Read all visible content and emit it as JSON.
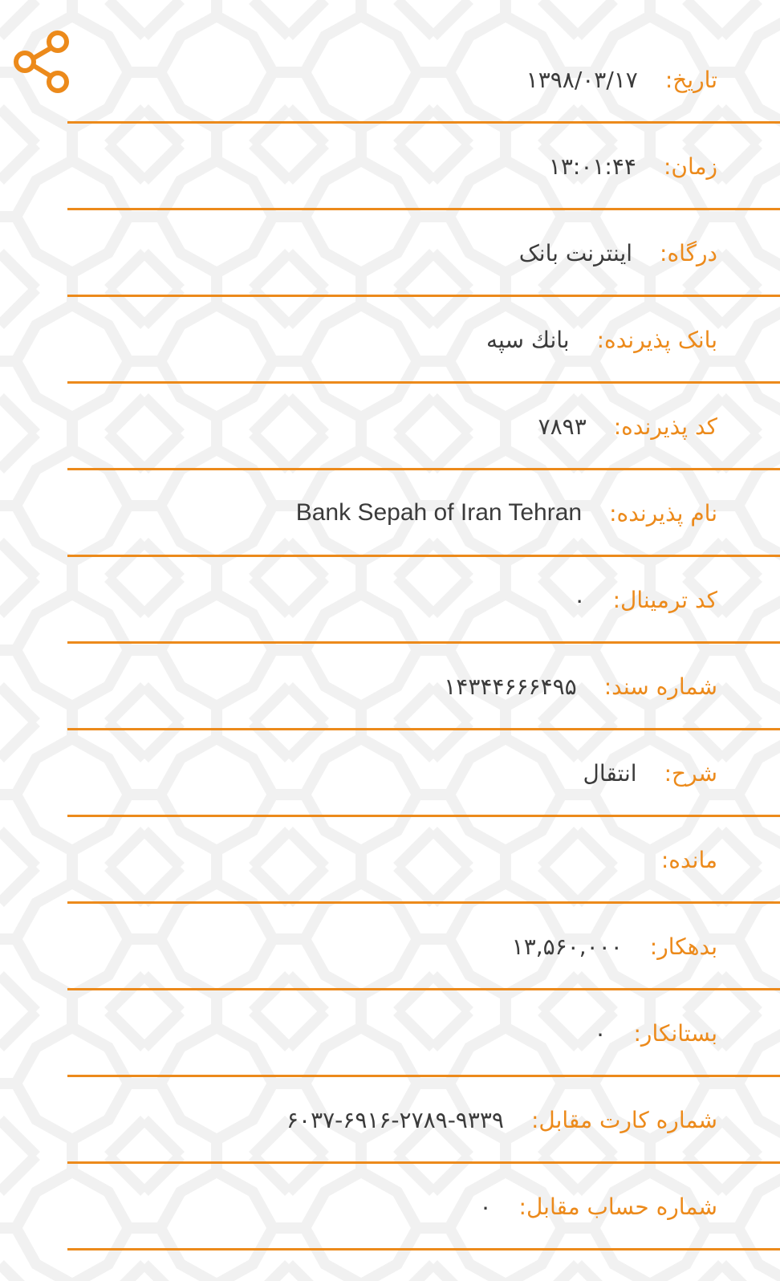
{
  "colors": {
    "accent": "#ec8a1b",
    "value_text": "#3b3b3b",
    "background": "#ffffff"
  },
  "share": {
    "icon": "share-icon"
  },
  "rows": [
    {
      "label": "تاریخ:",
      "value": "۱۳۹۸/۰۳/۱۷"
    },
    {
      "label": "زمان:",
      "value": "۱۳:۰۱:۴۴"
    },
    {
      "label": "درگاه:",
      "value": "اینترنت بانک"
    },
    {
      "label": "بانک پذیرنده:",
      "value": "بانك سپه"
    },
    {
      "label": "کد پذیرنده:",
      "value": "۷۸۹۳"
    },
    {
      "label": "نام پذیرنده:",
      "value": "Bank Sepah of Iran Tehran"
    },
    {
      "label": "کد ترمینال:",
      "value": "۰"
    },
    {
      "label": "شماره سند:",
      "value": "۱۴۳۴۴۶۶۶۴۹۵"
    },
    {
      "label": "شرح:",
      "value": "انتقال"
    },
    {
      "label": "مانده:",
      "value": ""
    },
    {
      "label": "بدهکار:",
      "value": "۱۳,۵۶۰,۰۰۰"
    },
    {
      "label": "بستانکار:",
      "value": "۰"
    },
    {
      "label": "شماره کارت مقابل:",
      "value": "۶۰۳۷-۶۹۱۶-۲۷۸۹-۹۳۳۹"
    },
    {
      "label": "شماره حساب مقابل:",
      "value": "۰"
    }
  ]
}
